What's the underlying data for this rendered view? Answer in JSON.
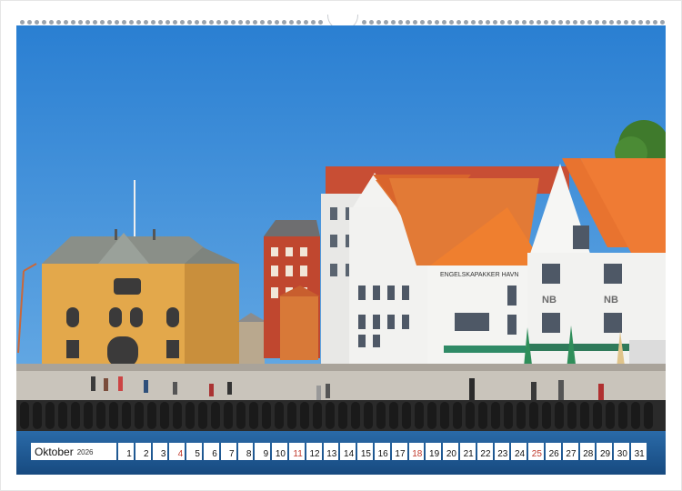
{
  "calendar": {
    "month": "Oktober",
    "year": "2026",
    "days": [
      "1",
      "2",
      "3",
      "4",
      "5",
      "6",
      "7",
      "8",
      "9",
      "10",
      "11",
      "12",
      "13",
      "14",
      "15",
      "16",
      "17",
      "18",
      "19",
      "20",
      "21",
      "22",
      "23",
      "24",
      "25",
      "26",
      "27",
      "28",
      "29",
      "30",
      "31"
    ],
    "sundays": [
      "4",
      "11",
      "18",
      "25"
    ]
  },
  "photo": {
    "sign_text": "ENGELSKAPAKKER HAVN",
    "building_letters_left": "NB",
    "building_letters_right": "NB"
  },
  "colors": {
    "sky": "#2f86d6",
    "sea": "#1f5e9e",
    "roof": "#e07a2f",
    "sunday": "#c0392b"
  }
}
